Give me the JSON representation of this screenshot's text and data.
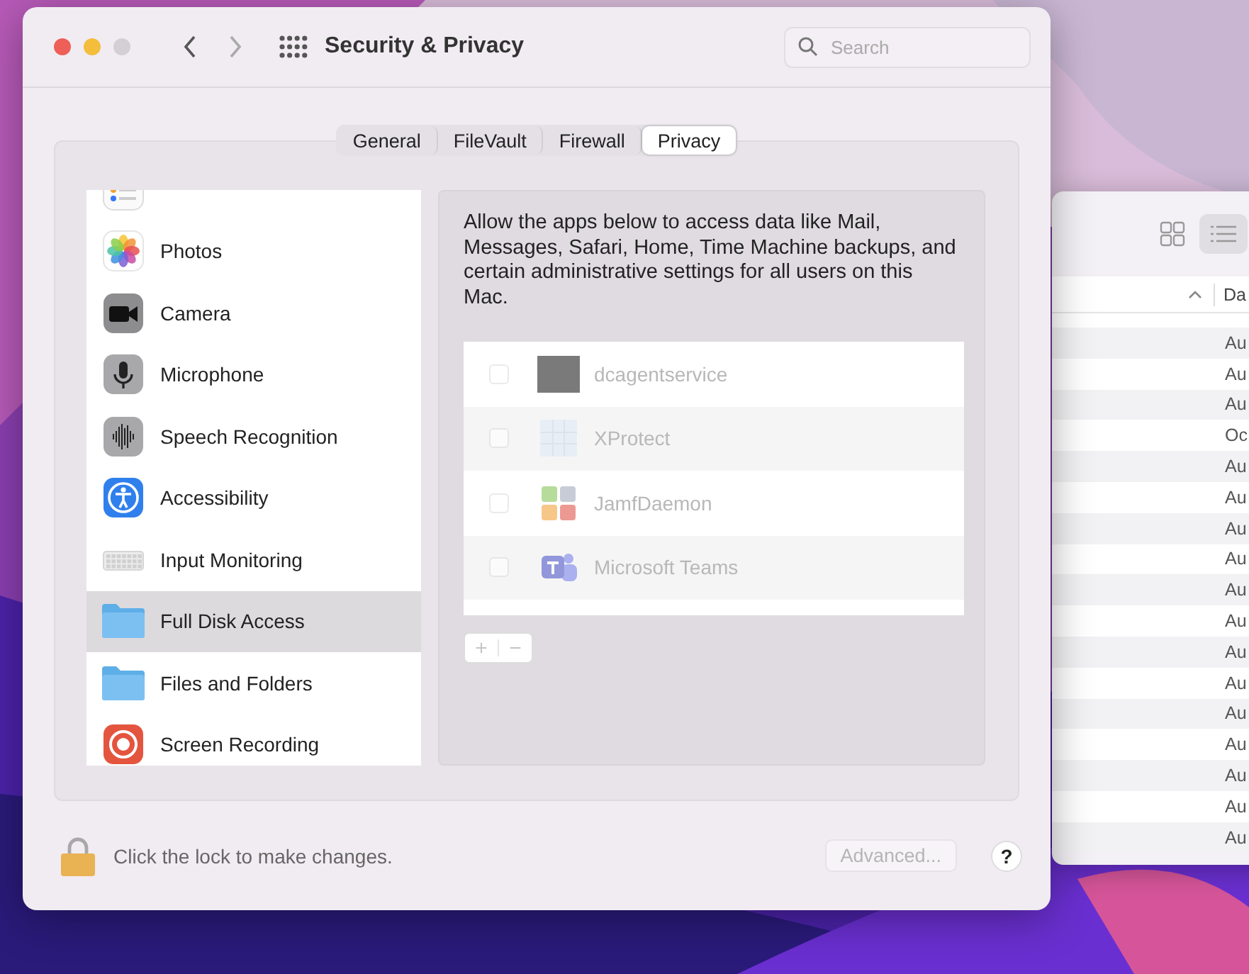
{
  "window": {
    "title": "Security & Privacy"
  },
  "search": {
    "placeholder": "Search"
  },
  "tabs": [
    {
      "label": "General",
      "selected": false
    },
    {
      "label": "FileVault",
      "selected": false
    },
    {
      "label": "Firewall",
      "selected": false
    },
    {
      "label": "Privacy",
      "selected": true
    }
  ],
  "sidebar": {
    "items": [
      {
        "label": "Photos",
        "selected": false
      },
      {
        "label": "Camera",
        "selected": false
      },
      {
        "label": "Microphone",
        "selected": false
      },
      {
        "label": "Speech Recognition",
        "selected": false
      },
      {
        "label": "Accessibility",
        "selected": false
      },
      {
        "label": "Input Monitoring",
        "selected": false
      },
      {
        "label": "Full Disk Access",
        "selected": true
      },
      {
        "label": "Files and Folders",
        "selected": false
      },
      {
        "label": "Screen Recording",
        "selected": false
      }
    ]
  },
  "description": "Allow the apps below to access data like Mail, Messages, Safari, Home, Time Machine backups, and certain administrative settings for all users on this Mac.",
  "apps": [
    {
      "name": "dcagentservice",
      "checked": false,
      "disabled": true
    },
    {
      "name": "XProtect",
      "checked": false,
      "disabled": true
    },
    {
      "name": "JamfDaemon",
      "checked": false,
      "disabled": true
    },
    {
      "name": "Microsoft Teams",
      "checked": false,
      "disabled": true
    }
  ],
  "list_buttons": {
    "add": "+",
    "remove": "−",
    "disabled": true
  },
  "footer": {
    "lock_text": "Click the lock to make changes.",
    "advanced": {
      "label": "Advanced...",
      "disabled": true
    },
    "help": "?"
  },
  "finder": {
    "header": "Da",
    "rows": [
      "Au",
      "Au",
      "Au",
      "Oc",
      "Au",
      "Au",
      "Au",
      "Au",
      "Au",
      "Au",
      "Au",
      "Au",
      "Au",
      "Au",
      "Au",
      "Au",
      "Au"
    ]
  }
}
